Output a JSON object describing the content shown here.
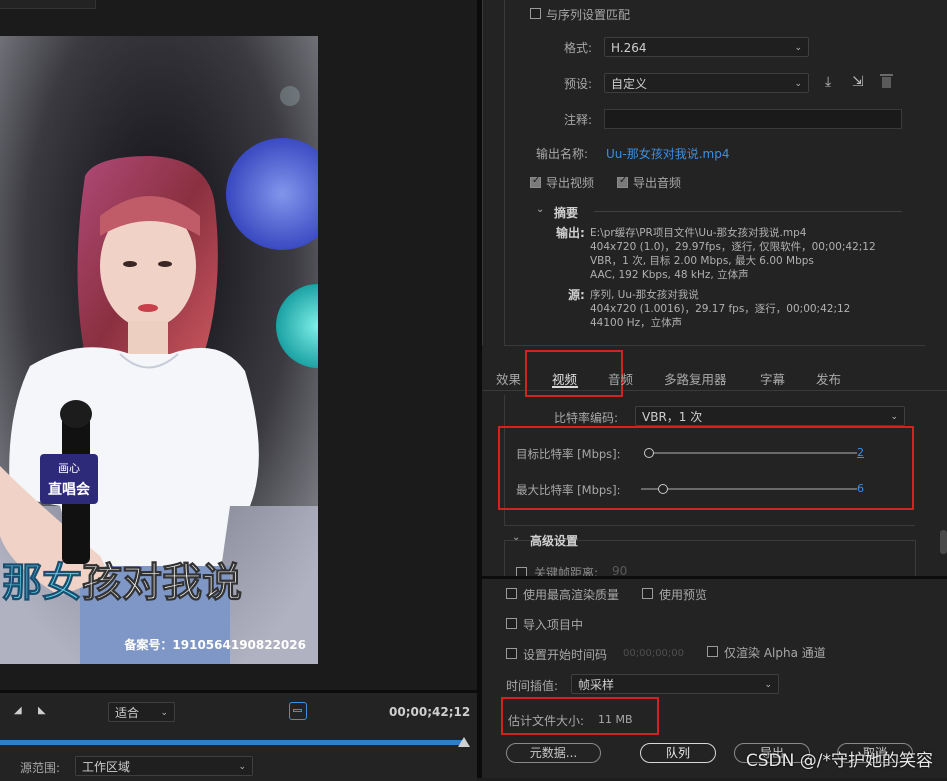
{
  "preview": {
    "subtitle_highlight": "那女",
    "subtitle_rest": "孩对我说",
    "record_number": "备案号：1910564190822026",
    "logo_line1": "画心",
    "logo_line2": "直唱会",
    "fit_value": "适合",
    "timecode": "00;00;42;12",
    "source_range_label": "源范围:",
    "source_range_value": "工作区域"
  },
  "export": {
    "match_sequence_label": "与序列设置匹配",
    "format_label": "格式:",
    "format_value": "H.264",
    "preset_label": "预设:",
    "preset_value": "自定义",
    "comment_label": "注释:",
    "comment_value": "",
    "output_name_label": "输出名称:",
    "output_name_value": "Uu-那女孩对我说.mp4",
    "export_video_label": "导出视频",
    "export_audio_label": "导出音频"
  },
  "summary": {
    "title": "摘要",
    "output_label": "输出:",
    "output_lines": [
      "E:\\pr缓存\\PR项目文件\\Uu-那女孩对我说.mp4",
      "404x720 (1.0)，29.97fps，逐行, 仅限软件，00;00;42;12",
      "VBR，1 次, 目标 2.00 Mbps, 最大 6.00 Mbps",
      "AAC, 192 Kbps, 48  kHz, 立体声"
    ],
    "source_label": "源:",
    "source_lines": [
      "序列, Uu-那女孩对我说",
      "404x720 (1.0016)，29.17 fps，逐行，00;00;42;12",
      "44100 Hz，立体声"
    ]
  },
  "tabs": [
    {
      "label": "效果",
      "active": false
    },
    {
      "label": "视频",
      "active": true
    },
    {
      "label": "音频",
      "active": false
    },
    {
      "label": "多路复用器",
      "active": false
    },
    {
      "label": "字幕",
      "active": false
    },
    {
      "label": "发布",
      "active": false
    }
  ],
  "video_settings": {
    "bitrate_encoding_label": "比特率编码:",
    "bitrate_encoding_value": "VBR，1 次",
    "target_bitrate_label": "目标比特率 [Mbps]:",
    "target_bitrate_value": "2",
    "target_bitrate_fraction": 0.02,
    "max_bitrate_label": "最大比特率 [Mbps]:",
    "max_bitrate_value": "6",
    "max_bitrate_fraction": 0.1,
    "advanced_label": "高级设置",
    "keyframe_label": "关键帧距离:",
    "keyframe_value": "90"
  },
  "render_options": {
    "max_render_quality": "使用最高渲染质量",
    "use_previews": "使用预览",
    "import_into_project": "导入项目中",
    "set_start_timecode": "设置开始时间码",
    "start_timecode_value": "00;00;00;00",
    "render_alpha_only": "仅渲染 Alpha 通道",
    "time_interpolation_label": "时间插值:",
    "time_interpolation_value": "帧采样",
    "estimated_size_label": "估计文件大小:",
    "estimated_size_value": "11 MB"
  },
  "buttons": {
    "metadata": "元数据...",
    "queue": "队列",
    "export": "导出",
    "cancel": "取消"
  },
  "watermark": "CSDN @/*守护她的笑容"
}
